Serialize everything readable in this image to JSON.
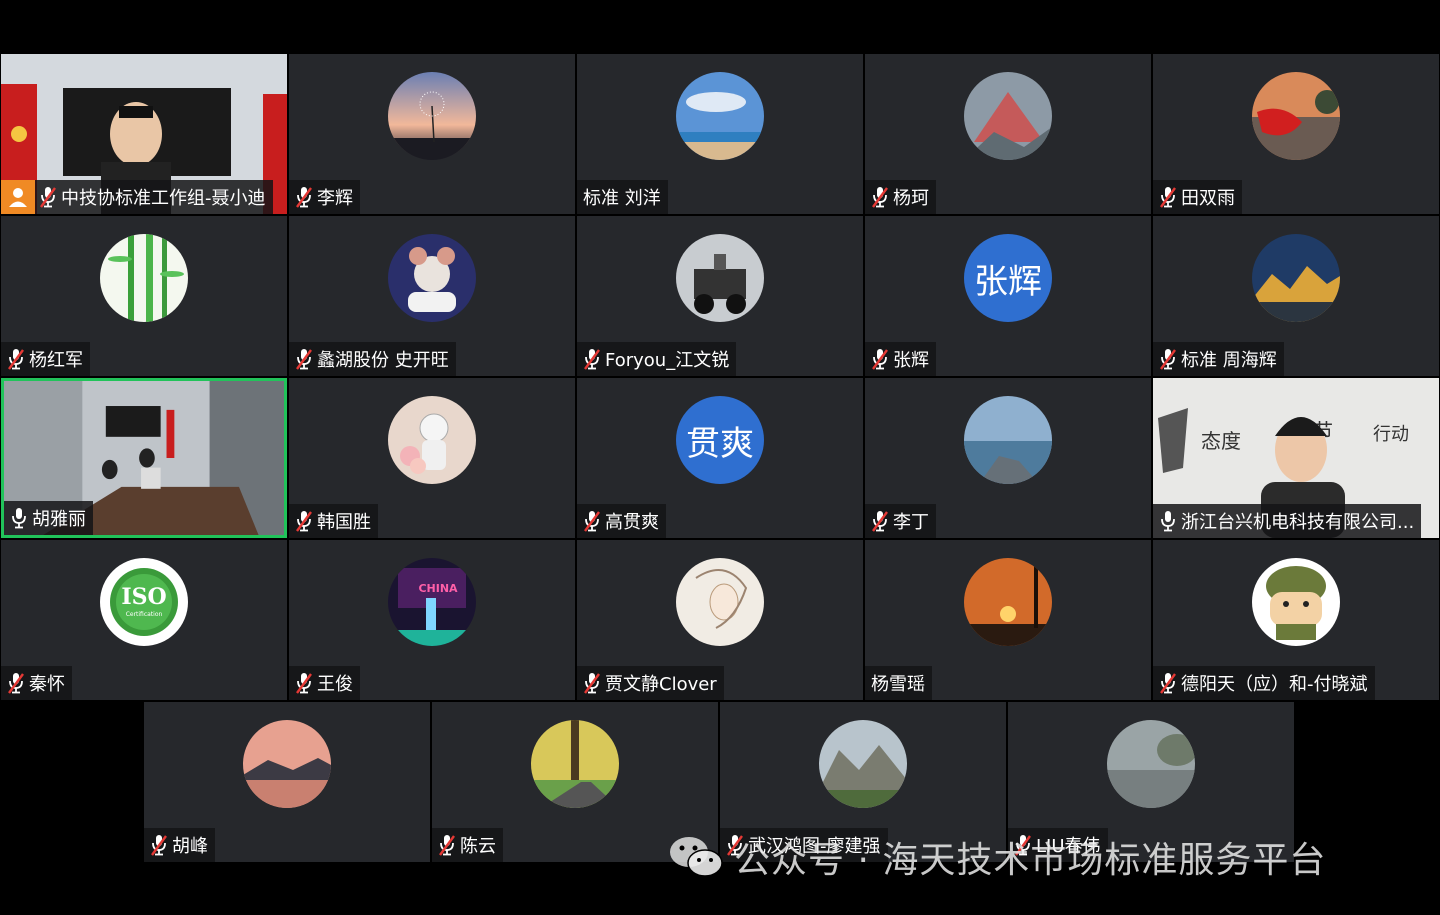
{
  "participants": [
    {
      "name": "中技协标准工作组-聂小迪",
      "mic": "muted",
      "type": "video",
      "host": true
    },
    {
      "name": "李辉",
      "mic": "muted",
      "type": "avatar",
      "avatar": "dandelion-sunset"
    },
    {
      "name": "标准 刘洋",
      "mic": "none",
      "type": "avatar",
      "avatar": "sky-beach"
    },
    {
      "name": "杨珂",
      "mic": "muted",
      "type": "avatar",
      "avatar": "mountain-peak"
    },
    {
      "name": "田双雨",
      "mic": "muted",
      "type": "avatar",
      "avatar": "flag-sunset"
    },
    {
      "name": "杨红军",
      "mic": "muted",
      "type": "avatar",
      "avatar": "bamboo"
    },
    {
      "name": "蠡湖股份 史开旺",
      "mic": "muted",
      "type": "avatar",
      "avatar": "cartoon-mouse"
    },
    {
      "name": "Foryou_江文锐",
      "mic": "muted",
      "type": "avatar",
      "avatar": "motorcycle"
    },
    {
      "name": "张辉",
      "mic": "muted",
      "type": "text",
      "avatar_text": "张辉"
    },
    {
      "name": "标准  周海辉",
      "mic": "muted",
      "type": "avatar",
      "avatar": "golden-mountains"
    },
    {
      "name": "胡雅丽",
      "mic": "active",
      "type": "video",
      "active": true
    },
    {
      "name": "韩国胜",
      "mic": "muted",
      "type": "avatar",
      "avatar": "astronaut-flowers"
    },
    {
      "name": "高贯爽",
      "mic": "muted",
      "type": "text",
      "avatar_text": "贯爽"
    },
    {
      "name": "李丁",
      "mic": "muted",
      "type": "avatar",
      "avatar": "sea-rock"
    },
    {
      "name": "浙江台兴机电科技有限公司...",
      "mic": "active",
      "type": "video"
    },
    {
      "name": "秦怀",
      "mic": "muted",
      "type": "avatar",
      "avatar": "iso-badge",
      "avatar_text": "ISO",
      "avatar_subtext": "Certification"
    },
    {
      "name": "王俊",
      "mic": "muted",
      "type": "avatar",
      "avatar": "neon-night",
      "avatar_text": "CHINA"
    },
    {
      "name": "贾文静Clover",
      "mic": "muted",
      "type": "avatar",
      "avatar": "sketch-girl"
    },
    {
      "name": "杨雪瑶",
      "mic": "none",
      "type": "avatar",
      "avatar": "sunset-silhouette"
    },
    {
      "name": "德阳天（应）和-付晓斌",
      "mic": "muted",
      "type": "avatar",
      "avatar": "cartoon-soldier"
    },
    {
      "name": "胡峰",
      "mic": "muted",
      "type": "avatar",
      "avatar": "lake-dusk"
    },
    {
      "name": "陈云",
      "mic": "muted",
      "type": "avatar",
      "avatar": "tree-road"
    },
    {
      "name": "武汉鸿图-廖建强",
      "mic": "muted",
      "type": "avatar",
      "avatar": "rocky-hills"
    },
    {
      "name": "LIU春伟",
      "mic": "muted",
      "type": "avatar",
      "avatar": "foggy-road"
    }
  ],
  "video_scenes": {
    "meeting_room_text": "",
    "banner_words": [
      "态度",
      "细节",
      "行动"
    ]
  },
  "watermark": {
    "text": "公众号 · 海天技术市场标准服务平台",
    "icon": "wechat-icon"
  },
  "colors": {
    "tile_bg": "#26282c",
    "active_border": "#21c35a",
    "host_badge": "#f08a24",
    "text_avatar_bg": "#2f6fd0"
  }
}
